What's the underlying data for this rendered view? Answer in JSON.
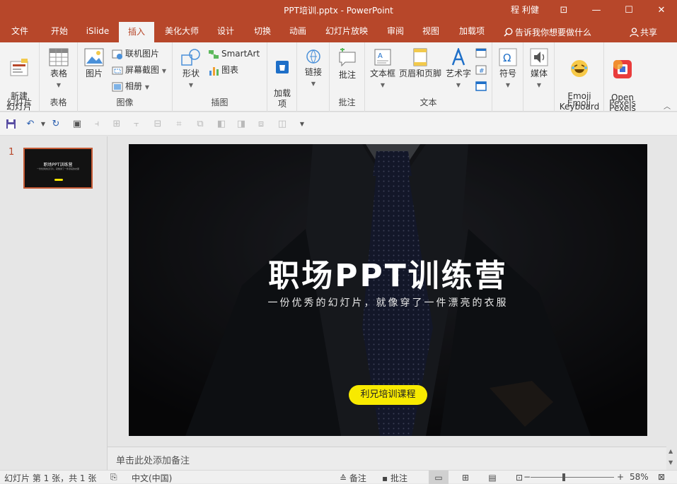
{
  "titlebar": {
    "title": "PPT培训.pptx  -  PowerPoint",
    "user": "程 利健",
    "ribbon_display_glyph": "⊡",
    "minimize_glyph": "—",
    "restore_glyph": "☐",
    "close_glyph": "✕"
  },
  "tabs": [
    "文件",
    "开始",
    "iSlide",
    "插入",
    "美化大师",
    "设计",
    "切换",
    "动画",
    "幻灯片放映",
    "审阅",
    "视图",
    "加载项"
  ],
  "active_tab": "插入",
  "tell_me": "告诉我你想要做什么",
  "share": "共享",
  "ribbon": {
    "new_slide": "新建\n幻灯片",
    "group_slides": "幻灯片",
    "table": "表格",
    "group_tables": "表格",
    "pictures": "图片",
    "online_pictures": "联机图片",
    "screenshot": "屏幕截图",
    "album": "相册",
    "group_images": "图像",
    "shapes": "形状",
    "smartart": "SmartArt",
    "chart": "图表",
    "group_illustrations": "插图",
    "addins": "加载\n项",
    "links": "链接",
    "comment": "批注",
    "group_comments": "批注",
    "textbox": "文本框",
    "header_footer": "页眉和页脚",
    "wordart": "艺术字",
    "group_text": "文本",
    "symbols": "符号",
    "media": "媒体",
    "emoji": "Emoji\nKeyboard",
    "group_emoji": "Emoji",
    "pexels": "Open\nPexels",
    "group_pexels": "Pexels"
  },
  "thumb": {
    "number": "1",
    "title": "职场PPT训练营",
    "subtitle": "一份优秀的幻灯片，就像穿了一件漂亮的衣服"
  },
  "slide": {
    "title": "职场PPT训练营",
    "subtitle": "一份优秀的幻灯片，就像穿了一件漂亮的衣服",
    "button": "利兄培训课程"
  },
  "notes_placeholder": "单击此处添加备注",
  "status": {
    "slide_info": "幻灯片 第 1 张，共 1 张",
    "language": "中文(中国)",
    "notes": "备注",
    "comments": "批注",
    "zoom": "58%"
  },
  "colors": {
    "accent": "#b7472a",
    "button": "#f8ea00"
  }
}
